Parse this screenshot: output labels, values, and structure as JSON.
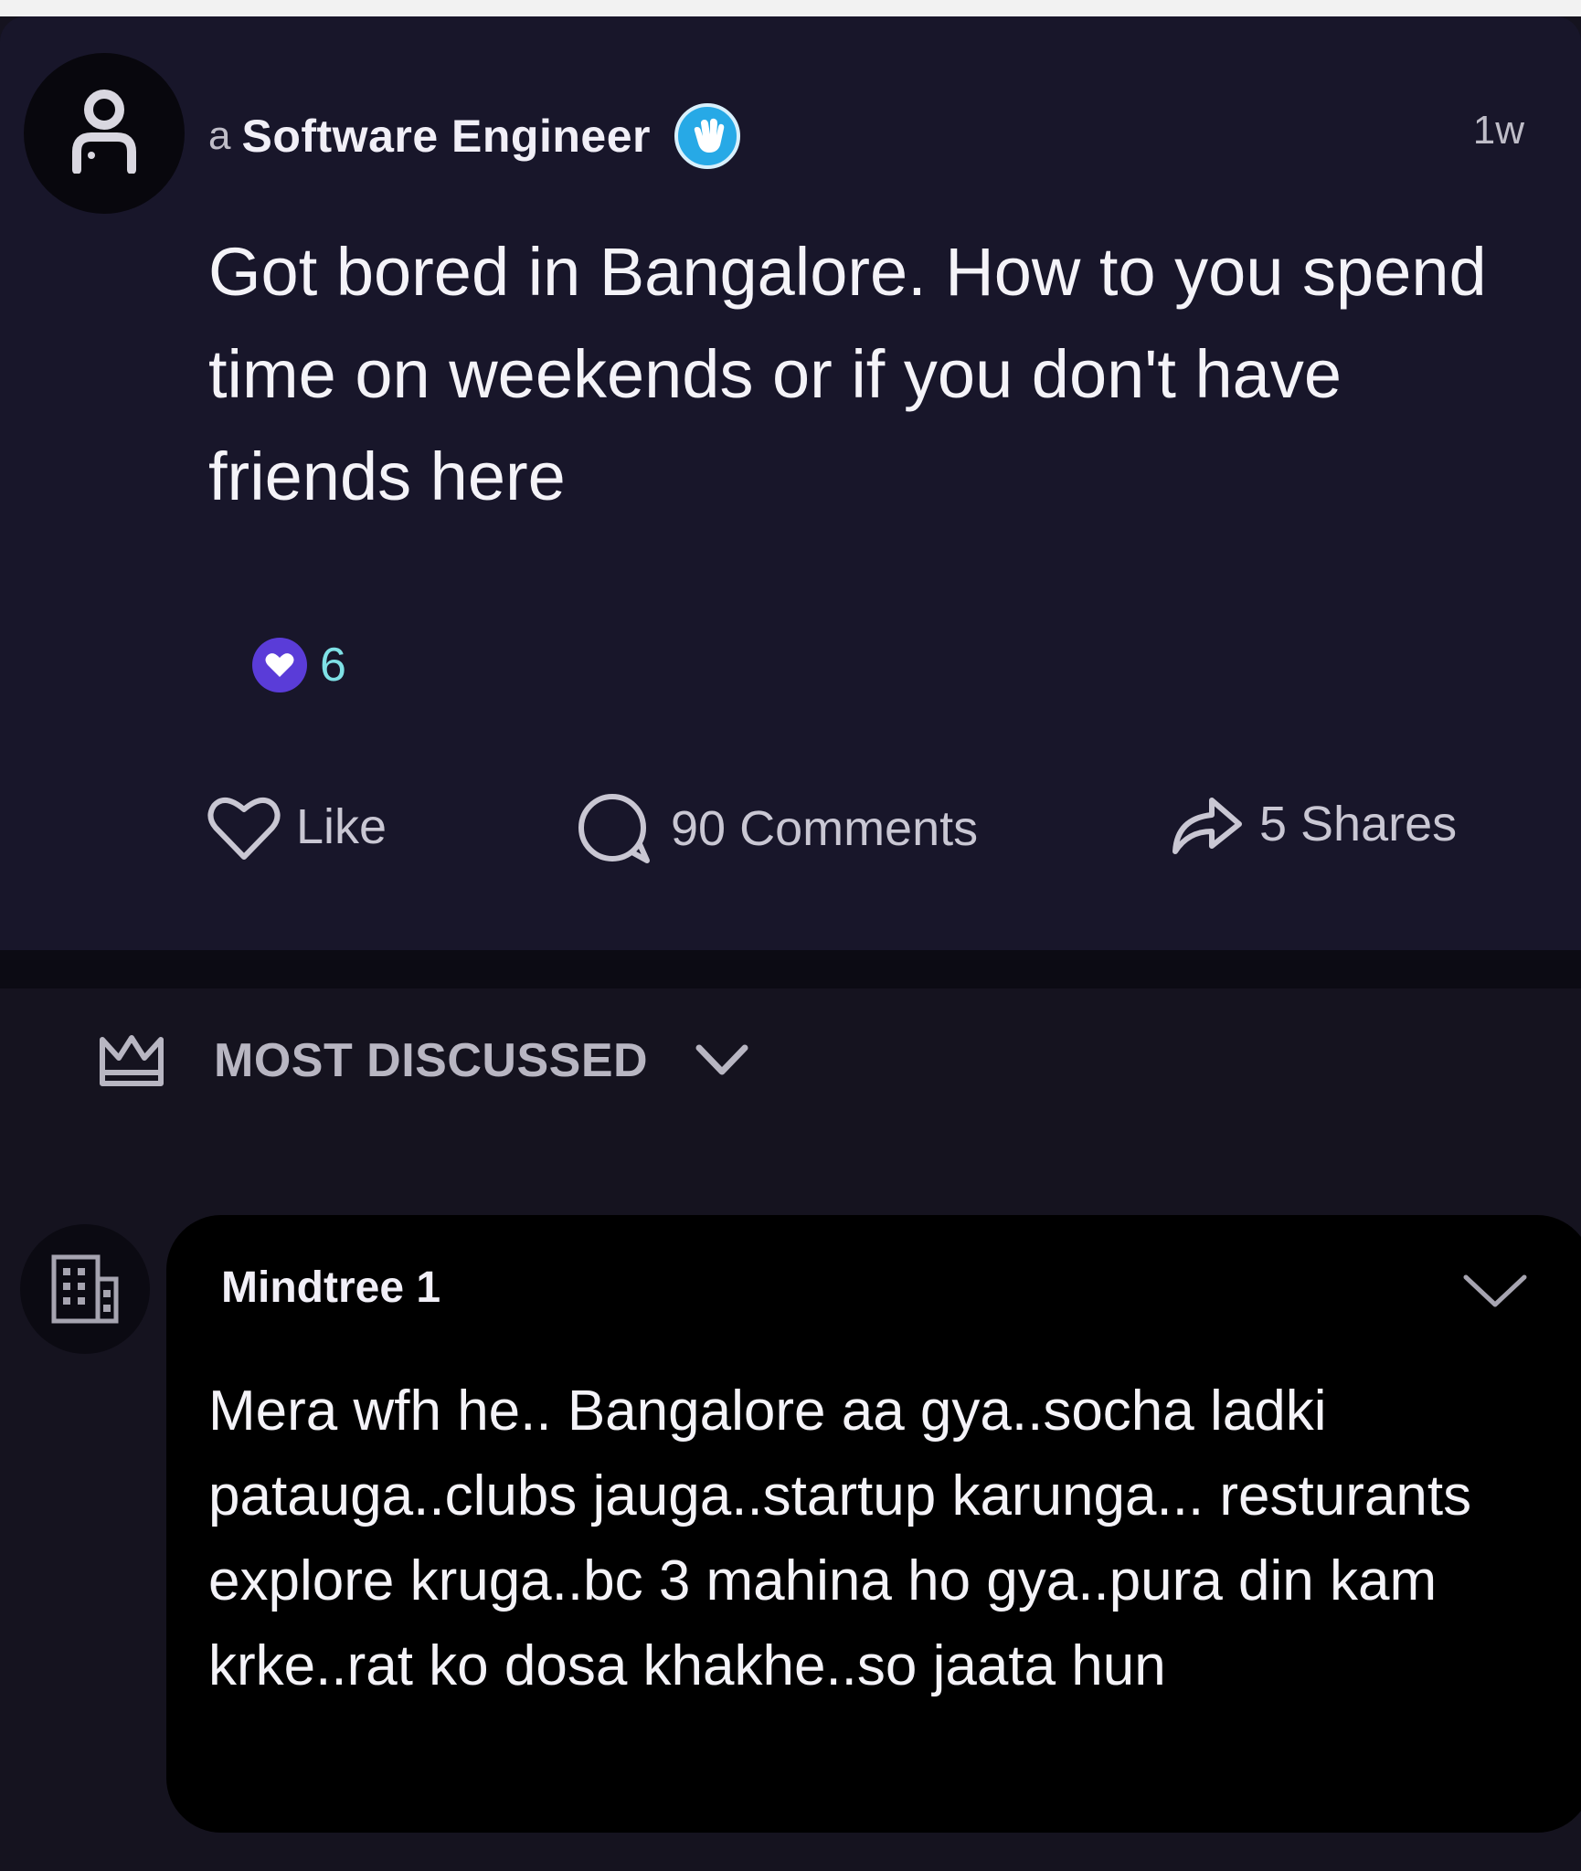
{
  "post": {
    "author_prefix": "a",
    "author_name": "Software Engineer",
    "time": "1w",
    "body": "Got bored in Bangalore. How to you spend time on weekends or if you don't have friends here",
    "reaction_count": "6",
    "actions": {
      "like_label": "Like",
      "comments_label": "90 Comments",
      "shares_label": "5 Shares"
    },
    "icons": {
      "avatar": "user-icon",
      "verified": "wave-hand-badge-icon",
      "reaction": "heart-icon",
      "like": "heart-outline-icon",
      "comment": "comment-bubble-icon",
      "share": "share-arrow-icon"
    }
  },
  "sort": {
    "label": "MOST DISCUSSED",
    "icon": "crown-icon",
    "chevron": "chevron-down-icon"
  },
  "comment": {
    "author": "Mindtree 1",
    "body": "Mera wfh he.. Bangalore aa gya..socha ladki patauga..clubs jauga..startup karunga... resturants explore kruga..bc 3 mahina ho gya..pura din kam krke..rat ko dosa khakhe..so jaata hun",
    "avatar_icon": "building-icon"
  },
  "colors": {
    "background": "#15131f",
    "card": "#18162a",
    "comment_card": "#000000",
    "verified_blue": "#27a9e6",
    "reaction_purple": "#5a3cd8",
    "reaction_count": "#7fe1e6"
  }
}
